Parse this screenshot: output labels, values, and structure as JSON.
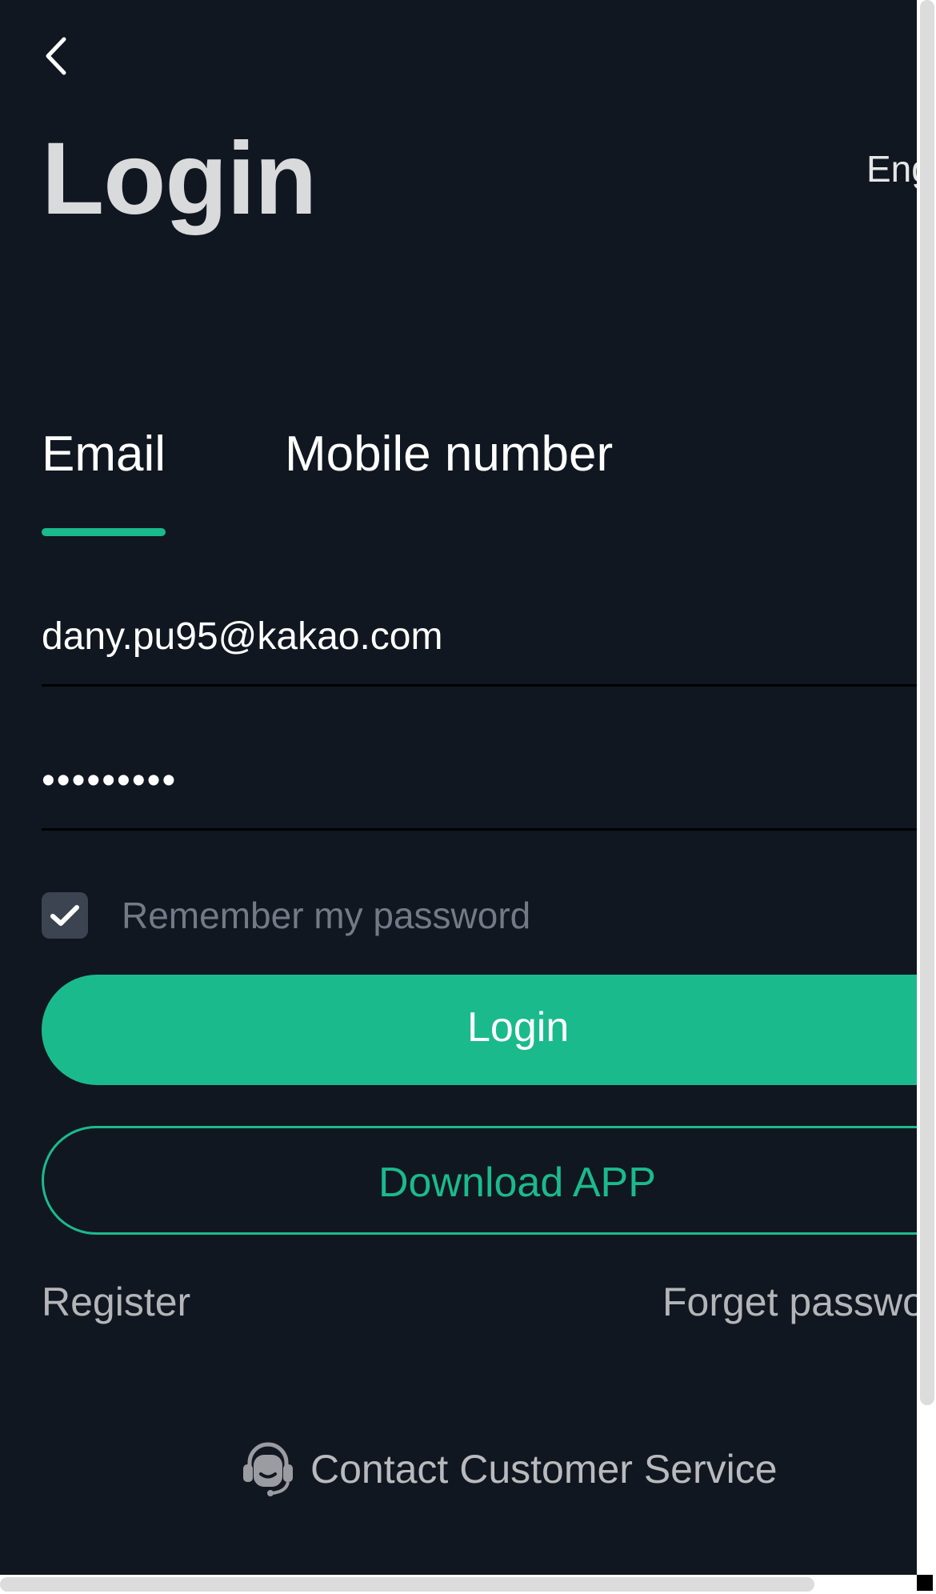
{
  "header": {
    "back_icon": "chevron-left-icon",
    "title": "Login",
    "language": "English"
  },
  "tabs": [
    {
      "label": "Email",
      "active": true
    },
    {
      "label": "Mobile number",
      "active": false
    }
  ],
  "form": {
    "email_value": "dany.pu95@kakao.com",
    "password_value": "•••••••••",
    "remember_label": "Remember my password",
    "remember_checked": true,
    "login_label": "Login",
    "download_label": "Download APP"
  },
  "links": {
    "register": "Register",
    "forget_password": "Forget password?"
  },
  "support": {
    "icon": "headset-icon",
    "label": "Contact Customer Service"
  },
  "colors": {
    "background": "#111720",
    "accent": "#1bba8d",
    "title_text": "#d9dadc",
    "muted_text": "#737a85"
  }
}
